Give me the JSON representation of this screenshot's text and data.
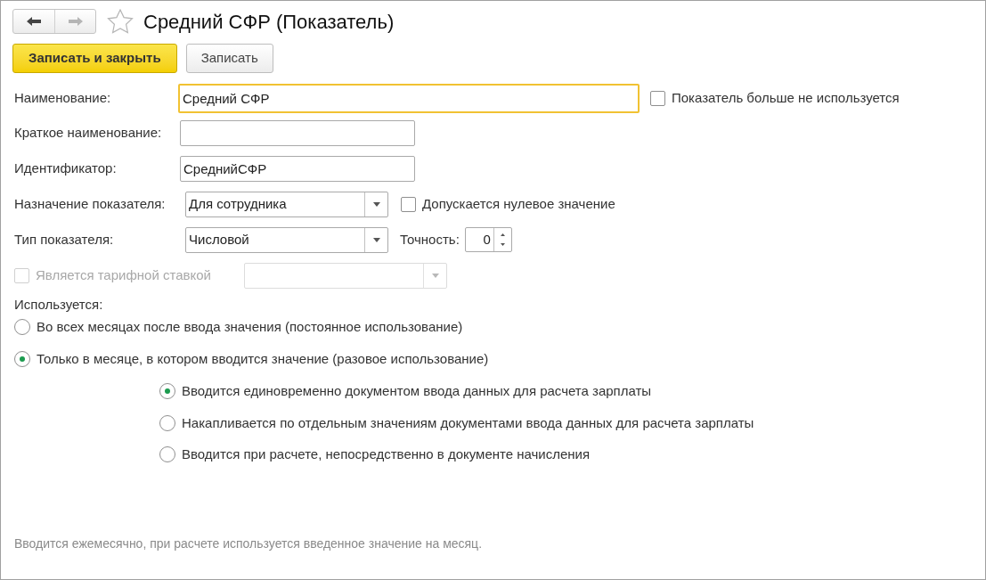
{
  "window": {
    "title": "Средний СФР (Показатель)",
    "favorite": false
  },
  "nav_buttons": [
    {
      "kind": "back",
      "disabled": false
    },
    {
      "kind": "forward",
      "disabled": true
    }
  ],
  "buttons": [
    {
      "label": "Записать и закрыть",
      "primary": true
    },
    {
      "label": "Записать",
      "primary": false
    }
  ],
  "name_field": {
    "label": "Наименование:",
    "value": "Средний СФР",
    "focused": true
  },
  "unused_checkbox": {
    "label": "Показатель больше не используется",
    "checked": false
  },
  "short_name_field": {
    "label": "Краткое наименование:"
  },
  "identifier_field": {
    "label": "Идентификатор:",
    "value": "СреднийСФР"
  },
  "purpose_select": {
    "label": "Назначение показателя:",
    "value": "Для сотрудника"
  },
  "zero_checkbox": {
    "label": "Допускается нулевое значение",
    "checked": false
  },
  "type_select": {
    "label": "Тип показателя:",
    "value": "Числовой"
  },
  "precision": {
    "label": "Точность:",
    "value": "0"
  },
  "tariff": {
    "label": "Является тарифной ставкой",
    "checked": false,
    "disabled": true
  },
  "usage": {
    "label": "Используется:",
    "options": [
      {
        "label": "Во всех месяцах после ввода значения (постоянное использование)",
        "selected": false
      },
      {
        "label": "Только в месяце, в котором вводится значение (разовое использование)",
        "selected": true
      }
    ]
  },
  "input_mode": {
    "options": [
      {
        "label": "Вводится единовременно документом ввода данных для расчета зарплаты",
        "selected": true
      },
      {
        "label": "Накапливается по отдельным значениям документами ввода данных для расчета зарплаты",
        "selected": false
      },
      {
        "label": "Вводится при расчете, непосредственно в документе начисления",
        "selected": false
      }
    ]
  },
  "hint": "Вводится ежемесячно, при расчете используется введенное значение на месяц."
}
